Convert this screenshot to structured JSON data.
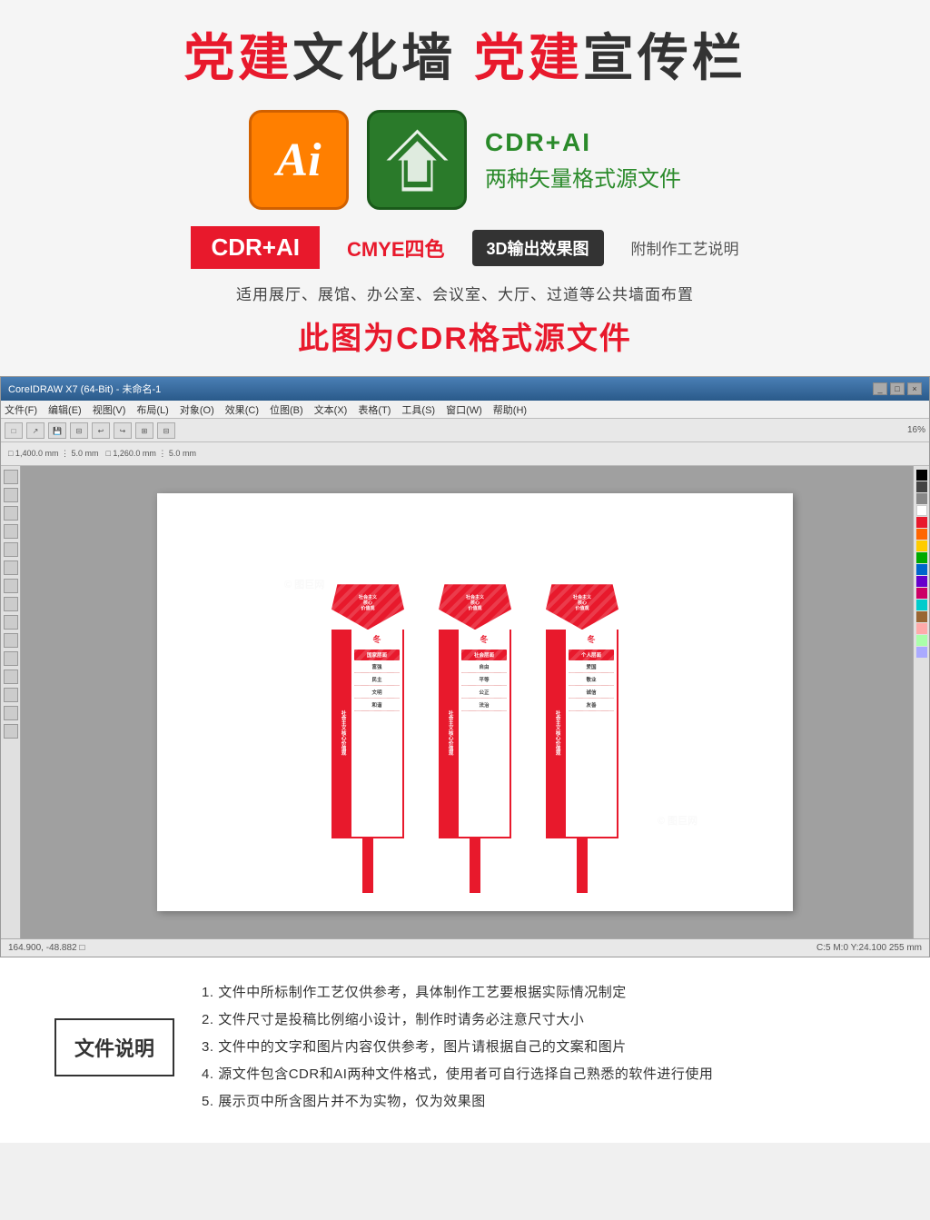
{
  "header": {
    "main_title_part1": "党建",
    "main_title_mid1": "文化墙  ",
    "main_title_part2": "党建",
    "main_title_mid2": "宣传栏"
  },
  "logos": {
    "ai_label": "Ai",
    "format_line1": "CDR+AI",
    "format_line2": "两种矢量格式源文件"
  },
  "info_row": {
    "cdr_badge": "CDR+AI",
    "cmyk_text": "CMYE四色",
    "effect_badge": "3D输出效果图",
    "note": "附制作工艺说明"
  },
  "desc": "适用展厅、展馆、办公室、会议室、大厅、过道等公共墙面布置",
  "sub_title": "此图为CDR格式源文件",
  "cdr_window": {
    "title": "CoreIDRAW X7 (64-Bit) - 未命名-1",
    "menu_items": [
      "文件(F)",
      "编辑(E)",
      "视图(V)",
      "布局(L)",
      "对象(O)",
      "效果(C)",
      "位图(B)",
      "文本(X)",
      "表格(T)",
      "工具(S)",
      "窗口(W)",
      "帮助(H)"
    ],
    "statusbar_left": "164.900, -48.882 □",
    "statusbar_right": "C:5 M:0 Y:24.100  255 mm"
  },
  "signs": [
    {
      "head_text": "社会主义\n核心\n价值观",
      "stripe_text": "社会主义核心价值观",
      "title_box": "国家层面",
      "items": [
        "富强",
        "民主",
        "文明",
        "和谐"
      ]
    },
    {
      "head_text": "社会主义\n核心\n价值观",
      "stripe_text": "社会主义核心价值观",
      "title_box": "社会层面",
      "items": [
        "自由",
        "平等",
        "公正",
        "法治"
      ]
    },
    {
      "head_text": "社会主义\n核心\n价值观",
      "stripe_text": "社会主义核心价值观",
      "title_box": "个人层面",
      "items": [
        "爱国",
        "敬业",
        "诚信",
        "友善"
      ]
    }
  ],
  "notes_label": "文件说明",
  "notes": [
    "1. 文件中所标制作工艺仅供参考，具体制作工艺要根据实际情况制定",
    "2. 文件尺寸是投稿比例缩小设计，制作时请务必注意尺寸大小",
    "3. 文件中的文字和图片内容仅供参考，图片请根据自己的文案和图片",
    "4. 源文件包含CDR和AI两种文件格式，使用者可自行选择自己熟悉的软件进行使用",
    "5. 展示页中所含图片并不为实物，仅为效果图"
  ]
}
